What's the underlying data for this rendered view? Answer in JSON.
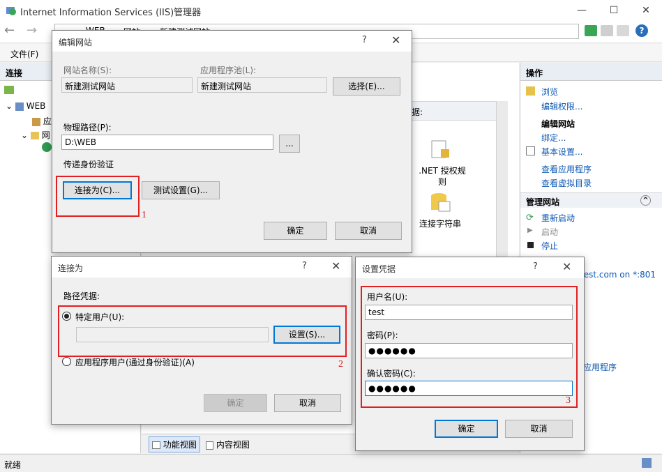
{
  "window": {
    "title": "Internet Information Services (IIS)管理器",
    "breadcrumb": [
      "WEB",
      "网站",
      "新建测试网站"
    ]
  },
  "menu": {
    "file": "文件(F)"
  },
  "left_pane": {
    "header": "连接",
    "tree": [
      "WEB",
      "应",
      "网"
    ]
  },
  "center": {
    "group_by_label": "依据:",
    "feature_net_auth": ".NET 授权规则",
    "feature_conn_strings": "连接字符串",
    "tab_features": "功能视图",
    "tab_content": "内容视图"
  },
  "right_pane": {
    "header": "操作",
    "actions": {
      "browse": "浏览",
      "edit_perms": "编辑权限...",
      "edit_site": "编辑网站",
      "bindings": "绑定...",
      "basic_settings": "基本设置...",
      "view_apps": "查看应用程序",
      "view_vdirs": "查看虚拟目录"
    },
    "manage_site": {
      "header": "管理网站",
      "restart": "重新启动",
      "start": "启动",
      "stop": "停止"
    },
    "browse_link": "test.com on *:801",
    "app_link": "应用程序"
  },
  "status": {
    "text": "就绪"
  },
  "edit_site_dialog": {
    "title": "编辑网站",
    "site_name_label": "网站名称(S):",
    "site_name_value": "新建测试网站",
    "app_pool_label": "应用程序池(L):",
    "app_pool_value": "新建测试网站",
    "select_button": "选择(E)...",
    "physical_path_label": "物理路径(P):",
    "physical_path_value": "D:\\WEB",
    "browse_button": "...",
    "pass_through_label": "传递身份验证",
    "connect_as_button": "连接为(C)...",
    "test_settings_button": "测试设置(G)...",
    "ok": "确定",
    "cancel": "取消",
    "marker": "1"
  },
  "connect_as_dialog": {
    "title": "连接为",
    "path_credentials_label": "路径凭据:",
    "specific_user_label": "特定用户(U):",
    "specific_user_value": "",
    "set_button": "设置(S)...",
    "app_user_label": "应用程序用户(通过身份验证)(A)",
    "ok": "确定",
    "cancel": "取消",
    "marker": "2"
  },
  "set_credentials_dialog": {
    "title": "设置凭据",
    "username_label": "用户名(U):",
    "username_value": "test",
    "password_label": "密码(P):",
    "password_value": "●●●●●●",
    "confirm_label": "确认密码(C):",
    "confirm_value": "●●●●●●",
    "ok": "确定",
    "cancel": "取消",
    "marker": "3"
  }
}
